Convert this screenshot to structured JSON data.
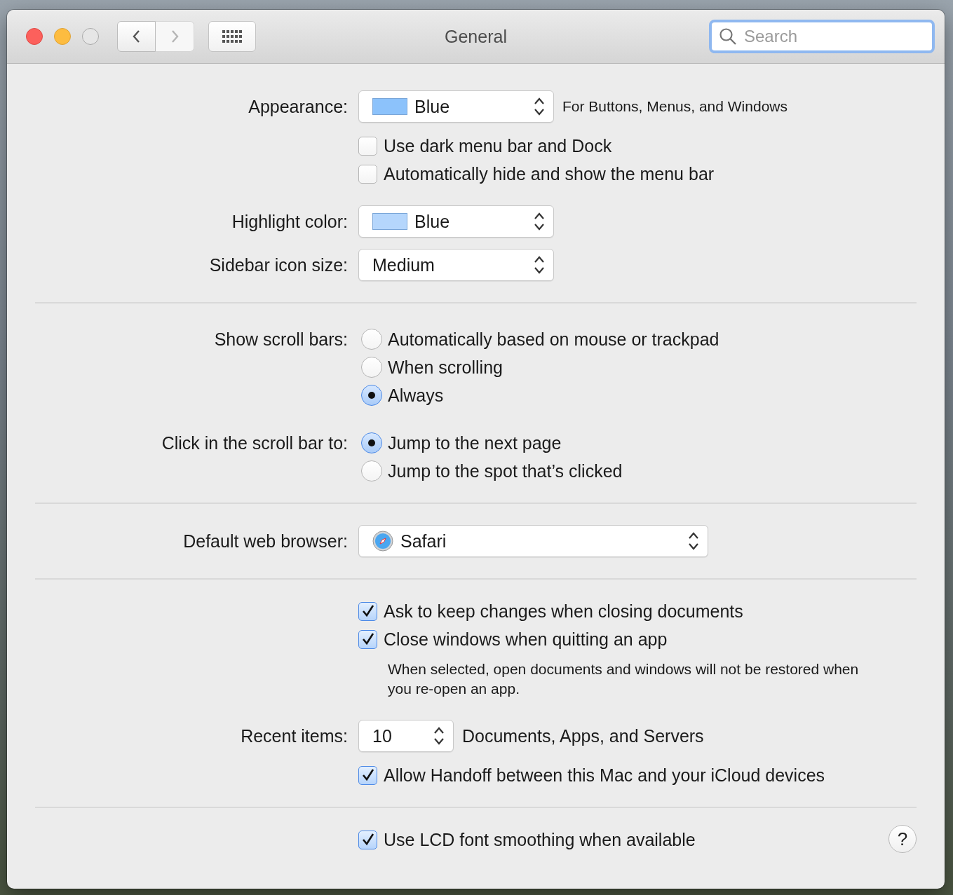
{
  "window": {
    "title": "General"
  },
  "nav": [
    {
      "kind": "back",
      "disabled": false
    },
    {
      "kind": "forward",
      "disabled": true
    }
  ],
  "search": {
    "placeholder": "Search"
  },
  "sections": [
    {
      "rows": [
        {
          "kind": "popup",
          "label": "Appearance:",
          "value": "Blue",
          "color": "#8cc2fb",
          "suffix": "For Buttons, Menus, and Windows"
        },
        {
          "kind": "checkbox",
          "text": "Use dark menu bar and Dock",
          "checked": false
        },
        {
          "kind": "checkbox",
          "text": "Automatically hide and show the menu bar",
          "checked": false
        },
        {
          "kind": "popup",
          "label": "Highlight color:",
          "value": "Blue",
          "color": "#b5d6fc"
        },
        {
          "kind": "popup",
          "label": "Sidebar icon size:",
          "value": "Medium"
        }
      ]
    },
    {
      "rows": [
        {
          "kind": "radios",
          "label": "Show scroll bars:",
          "options": [
            {
              "text": "Automatically based on mouse or trackpad",
              "selected": false
            },
            {
              "text": "When scrolling",
              "selected": false
            },
            {
              "text": "Always",
              "selected": true
            }
          ]
        },
        {
          "kind": "radios",
          "label": "Click in the scroll bar to:",
          "options": [
            {
              "text": "Jump to the next page",
              "selected": true
            },
            {
              "text": "Jump to the spot that’s clicked",
              "selected": false
            }
          ]
        }
      ]
    },
    {
      "rows": [
        {
          "kind": "browser",
          "label": "Default web browser:",
          "value": "Safari"
        }
      ]
    },
    {
      "rows": [
        {
          "kind": "checkbox",
          "text": "Ask to keep changes when closing documents",
          "checked": true
        },
        {
          "kind": "checkbox",
          "text": "Close windows when quitting an app",
          "checked": true
        },
        {
          "kind": "note",
          "text": "When selected, open documents and windows will not be restored when you re-open an app."
        },
        {
          "kind": "stepper",
          "label": "Recent items:",
          "value": "10",
          "suffix": "Documents, Apps, and Servers"
        },
        {
          "kind": "checkbox",
          "text": "Allow Handoff between this Mac and your iCloud devices",
          "checked": true
        }
      ]
    },
    {
      "rows": [
        {
          "kind": "checkbox",
          "text": "Use LCD font smoothing when available",
          "checked": true,
          "help": "?"
        }
      ]
    }
  ]
}
